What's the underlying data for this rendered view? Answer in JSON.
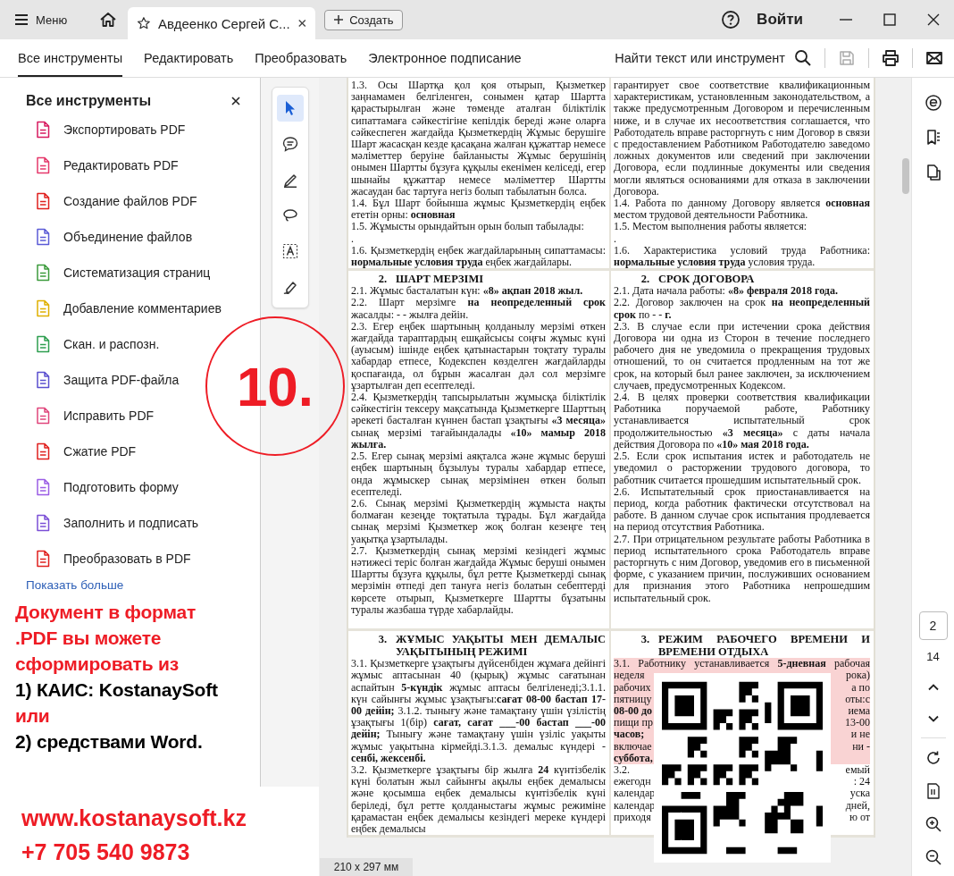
{
  "title_bar": {
    "menu": "Меню",
    "tab_title": "Авдеенко Сергей С...",
    "create": "Создать",
    "sign_in": "Войти"
  },
  "toolbar": {
    "tabs": [
      {
        "label": "Все инструменты",
        "selected": true
      },
      {
        "label": "Редактировать",
        "selected": false
      },
      {
        "label": "Преобразовать",
        "selected": false
      },
      {
        "label": "Электронное подписание",
        "selected": false
      }
    ],
    "search": "Найти текст или инструмент",
    "actions": [
      {
        "kind": "save",
        "disabled": true
      },
      {
        "kind": "print",
        "disabled": false
      },
      {
        "kind": "email",
        "disabled": false
      }
    ]
  },
  "panel": {
    "title": "Все инструменты",
    "items": [
      {
        "label": "Экспортировать PDF",
        "color": "#d81b60"
      },
      {
        "label": "Редактировать PDF",
        "color": "#e5396b"
      },
      {
        "label": "Создание файлов PDF",
        "color": "#e0201e"
      },
      {
        "label": "Объединение файлов",
        "color": "#5b5bd6"
      },
      {
        "label": "Систематизация страниц",
        "color": "#3c9b3c"
      },
      {
        "label": "Добавление комментариев",
        "color": "#e0b000"
      },
      {
        "label": "Скан. и распозн.",
        "color": "#2e9e4f"
      },
      {
        "label": "Защита PDF-файла",
        "color": "#5a4fcf"
      },
      {
        "label": "Исправить PDF",
        "color": "#e0457b"
      },
      {
        "label": "Сжатие PDF",
        "color": "#e0201e"
      },
      {
        "label": "Подготовить форму",
        "color": "#9b5de5"
      },
      {
        "label": "Заполнить и подписать",
        "color": "#7b4fd6"
      },
      {
        "label": "Преобразовать в PDF",
        "color": "#e0201e"
      }
    ],
    "more": "Показать больше"
  },
  "tool_strip": [
    {
      "kind": "select",
      "selected": true
    },
    {
      "kind": "comment",
      "selected": false
    },
    {
      "kind": "draw",
      "selected": false
    },
    {
      "kind": "lasso",
      "selected": false
    },
    {
      "kind": "text",
      "selected": false
    },
    {
      "kind": "sign",
      "selected": false
    }
  ],
  "document": {
    "rows": [
      {
        "left": {
          "paragraphs": [
            "1.3. Осы Шартқа қол қоя отырып, Қызметкер заңнамамен белгіленген, сонымен қатар  Шартта қарастырылған және төменде аталған біліктілік сипаттамаға сәйкестігіне кепілдік береді және оларға сәйкеспеген жағдайда Қызметкердің Жұмыс берушіге Шарт жасасқан кезде қасақана жалған құжаттар немесе мәліметтер беруіне байланысты Жұмыс берушінің онымен Шартты бұзуға құқылы екенімен келіседі, егер шынайы құжаттар немесе мәліметтер Шартты жасаудан бас тартуға негіз болып табылатын болса.",
            "1.4. Бұл Шарт бойынша жұмыс  Қызметкердің еңбек ететін орны: **основная**",
            "1.5. Жұмысты орындайтын орын болып табылады:",
            ".",
            "1.6. Қызметкердің еңбек жағдайларының сипаттамасы: **нормальные условия труда** еңбек жағдайлары."
          ]
        },
        "right": {
          "paragraphs": [
            "гарантирует свое соответствие квалификационным характеристикам, установленным законодательством, а также предусмотренным Договором и перечисленным ниже, и в случае их несоответствия соглашается, что Работодатель вправе расторгнуть с ним Договор в связи с предоставлением Работником Работодателю заведомо ложных документов или сведений при заключении Договора, если подлинные документы или сведения могли являться основаниями для отказа в заключении Договора.",
            "1.4. Работа по данному Договору является **основная** местом трудовой деятельности Работника.",
            "1.5. Местом выполнения работы является:",
            ".",
            "1.6. Характеристика условий труда Работника: **нормальные условия труда** условия труда."
          ]
        }
      },
      {
        "left": {
          "heading": {
            "number": "2.",
            "title": "ШАРТ МЕРЗІМІ"
          },
          "paragraphs": [
            "2.1. Жұмыс басталатын күн: **«8»  ақпан 2018 жыл.**",
            "2.2. Шарт мерзімге **на неопределенный срок** жасалды: -  -     жылға дейін.",
            "2.3. Егер еңбек шартының қолданылу мерзімі өткен жағдайда тараптардың ешқайсысы соңғы жұмыс күні (ауысым) ішінде еңбек қатынастарын тоқтату туралы хабардар етпесе, Кодекспен көзделген жағдайларды қоспағанда, ол бұрын жасалған дәл сол мерзімге ұзартылған деп есептеледі.",
            "2.4. Қызметкердің тапсырылатын жұмысқа біліктілік сәйкестігін тексеру мақсатында Қызметкерге Шарттың әрекеті басталған күннен бастап ұзақтығы **«3 месяца»** сынақ мерзімі тағайындалады **«10» мамыр 2018 жылға.**",
            "2.5. Егер сынақ мерзімі аяқталса және жұмыс беруші еңбек шартының бұзылуы туралы хабардар етпесе, онда жұмыскер сынақ мерзімінен өткен болып есептеледі.",
            "2.6. Сынақ мерзімі Қызметкердің жұмыста нақты болмаған кезеңде тоқтатыла тұрады. Бұл жағдайда сынақ мерзімі Қызметкер жоқ болған кезеңге тең уақытқа ұзартылады.",
            "2.7. Қызметкердің сынақ мерзімі кезіндегі жұмыс нәтижесі теріс болған жағдайда Жұмыс беруші онымен Шартты бұзуға құқылы, бұл ретте Қызметкерді сынақ мерзімін өтпеді деп тануға негіз болатын себептерді көрсете отырып, Қызметкерге Шартты бұзатыны туралы жазбаша түрде хабарлайды."
          ]
        },
        "right": {
          "heading": {
            "number": "2.",
            "title": "СРОК ДОГОВОРА"
          },
          "paragraphs": [
            "2.1. Дата начала работы: **«8»  февраля 2018 года.**",
            "2.2. Договор заключен на срок **на неопределенный срок** по  -  -    **г.**",
            "2.3. В случае если при истечении срока действия Договора ни одна из Сторон в течение последнего рабочего дня не уведомила о прекращения трудовых отношений, то он считается продленным на тот же срок, на который был ранее заключен, за исключением случаев, предусмотренных Кодексом.",
            "2.4. В целях проверки соответствия квалификации Работника поручаемой работе, Работнику устанавливается испытательный срок продолжительностью **«3 месяца»** с даты начала действия Договора по **«10» мая 2018 года.**",
            "2.5. Если срок испытания истек и работодатель не уведомил о расторжении трудового договора, то работник считается прошедшим испытательный срок.",
            "2.6. Испытательный срок приостанавливается на период, когда работник фактически отсутствовал на работе. В данном случае срок испытания продлевается на период отсутствия Работника.",
            "2.7. При отрицательном результате работы Работника в период испытательного срока Работодатель вправе расторгнуть с ним Договор, уведомив его в письменной форме, с указанием причин, послуживших основанием для признания этого Работника непрошедшим испытательный срок."
          ]
        }
      },
      {
        "left": {
          "heading": {
            "number": "3.",
            "title": "ЖҰМЫС УАҚЫТЫ МЕН ДЕМАЛЫС УАҚЫТЫНЫҢ РЕЖИМІ"
          },
          "paragraphs": [
            "3.1. Қызметкерге ұзақтығы дүйсенбіден жұмаға дейінгі жұмыс аптасынан 40 (қырық) жұмыс сағатынан аспайтын **5-күндік**  жұмыс аптасы белгіленеді;3.1.1. күн сайынғы жұмыс ұзақтығы:**сағат 08-00 бастап 17-00 дейін;** 3.1.2. тынығу және тамақтану үшін үзілістің ұзақтығы 1(бір) **сағат, сағат ___-00 бастап ___-00 дейін;** Тынығу және тамақтану үшін үзіліс уақыты жұмыс уақытына кірмейді.3.1.3. демалыс күндері - **сенбі, жексенбі.**",
            "3.2. Қызметкерге ұзақтығы бір жылға **24**  күнтізбелік күні болатын жыл сайынғы ақылы еңбек демалысы және қосымша еңбек демалысы  күнтізбелік күні беріледі, бұл ретте қолданыстағы жұмыс режиміне қарамастан еңбек демалысы кезіндегі мереке күндері еңбек демалысы"
          ]
        },
        "right": {
          "heading": {
            "number": "3.",
            "title": "РЕЖИМ РАБОЧЕГО ВРЕМЕНИ И ВРЕМЕНИ ОТДЫХА"
          },
          "lines": [
            {
              "kind": "full",
              "start": "3.1. Работнику устанавливается **5-дневная**  рабочая",
              "highlighted": true
            },
            {
              "kind": "split",
              "start": "неделя",
              "end": "рока)",
              "highlighted": true
            },
            {
              "kind": "split",
              "start": "рабочих",
              "end": "а по",
              "highlighted": true
            },
            {
              "kind": "split",
              "start": "пятницу",
              "end": "оты:с",
              "highlighted": true
            },
            {
              "kind": "split",
              "start": "**08-00 до**",
              "end": "иема",
              "highlighted": true
            },
            {
              "kind": "split",
              "start": "пищи пр",
              "end": "13-00",
              "highlighted": true
            },
            {
              "kind": "split",
              "start": "**часов;**",
              "end": "и не",
              "highlighted": true
            },
            {
              "kind": "split",
              "start": "включае",
              "end": "ни  -",
              "highlighted": true
            },
            {
              "kind": "split",
              "start": "**суббота,**",
              "highlighted": true
            },
            {
              "kind": "split",
              "start": "3.2.",
              "end": "емый",
              "highlighted": false
            },
            {
              "kind": "split",
              "start": "ежегодн",
              "end": ":  24",
              "highlighted": false
            },
            {
              "kind": "split",
              "start": "календар",
              "end": "уска",
              "highlighted": false
            },
            {
              "kind": "split",
              "start": "календар",
              "end": "дней,",
              "highlighted": false
            },
            {
              "kind": "split",
              "start": "приходя",
              "end": "ю от",
              "highlighted": false
            }
          ]
        }
      }
    ]
  },
  "page_size": "210 x 297 мм",
  "navigation": {
    "page": "2",
    "total": "14"
  },
  "overlay": {
    "stamp": "10.",
    "promo": [
      {
        "text": "Документ в формат",
        "color": "#ee1c25"
      },
      {
        "text": ".PDF вы можете",
        "color": "#ee1c25"
      },
      {
        "text": "сформировать из",
        "color": "#ee1c25"
      },
      {
        "text": "1) КАИС: KostanaySoft",
        "color": "#000000"
      },
      {
        "text": "или",
        "color": "#ee1c25"
      },
      {
        "text": "2) средствами Word.",
        "color": "#000000"
      }
    ],
    "contacts": [
      {
        "text": "www.kostanaysoft.kz",
        "color": "#ee1c25"
      },
      {
        "text": "+7 705 540 9873",
        "color": "#ee1c25"
      }
    ]
  }
}
